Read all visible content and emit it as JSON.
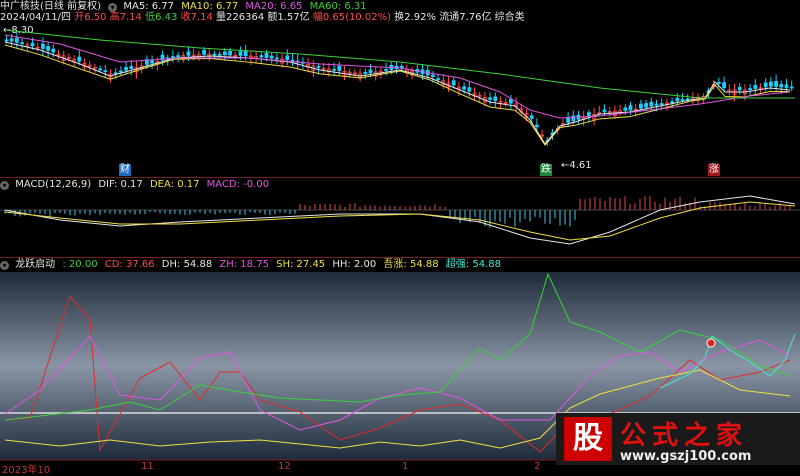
{
  "header": {
    "stock": "中广核技(日线 前复权)",
    "ma": [
      {
        "label": "MA5: 6.77",
        "color": "#e6e6e6"
      },
      {
        "label": "MA10: 6.77",
        "color": "#f0e040"
      },
      {
        "label": "MA20: 6.65",
        "color": "#e055e0"
      },
      {
        "label": "MA60: 6.31",
        "color": "#3ad23a"
      }
    ],
    "info": [
      {
        "text": "2024/04/11/四",
        "color": "#e6e6e6"
      },
      {
        "text": "开6.50",
        "color": "#ff4a4a"
      },
      {
        "text": "高7.14",
        "color": "#ff4a4a"
      },
      {
        "text": "低6.43",
        "color": "#3ad23a"
      },
      {
        "text": "收7.14",
        "color": "#ff4a4a"
      },
      {
        "text": "量226364",
        "color": "#e6e6e6"
      },
      {
        "text": "额1.57亿",
        "color": "#e6e6e6"
      },
      {
        "text": "幅0.65(10.02%)",
        "color": "#ff4a4a"
      },
      {
        "text": "换2.92%",
        "color": "#e6e6e6"
      },
      {
        "text": "流通7.76亿",
        "color": "#e6e6e6"
      },
      {
        "text": "综合类",
        "color": "#e6e6e6"
      }
    ],
    "high_label": "8.30",
    "low_label": "4.61"
  },
  "markers": {
    "cai": "财",
    "die": "跌",
    "zhang": "涨"
  },
  "macd": {
    "title": "MACD(12,26,9)",
    "dif": "DIF: 0.17",
    "dea": "DEA: 0.17",
    "macd": "MACD: -0.00"
  },
  "longtiao": {
    "title": "龙跃启动",
    "values": [
      {
        "label": ": 20.00",
        "color": "#3ad23a"
      },
      {
        "label": "CD: 37.66",
        "color": "#ff4a4a"
      },
      {
        "label": "DH: 54.88",
        "color": "#e6e6e6"
      },
      {
        "label": "ZH: 18.75",
        "color": "#e055e0"
      },
      {
        "label": "SH: 27.45",
        "color": "#f0e040"
      },
      {
        "label": "HH: 2.00",
        "color": "#e6e6e6"
      },
      {
        "label": "吾涨: 54.88",
        "color": "#f0e040"
      },
      {
        "label": "超强: 54.88",
        "color": "#46e8d2"
      }
    ]
  },
  "dates": [
    "2023年10",
    "11",
    "12",
    "1",
    "2"
  ],
  "logo": {
    "gu": "股",
    "name": "公式之家",
    "url": "www.gszj100.com"
  },
  "colors": {
    "up": "#ff4a4a",
    "down": "#19d0ff",
    "ma5": "#e6e6e6",
    "ma10": "#f0e040",
    "ma20": "#e055e0",
    "ma60": "#3ad23a"
  }
}
